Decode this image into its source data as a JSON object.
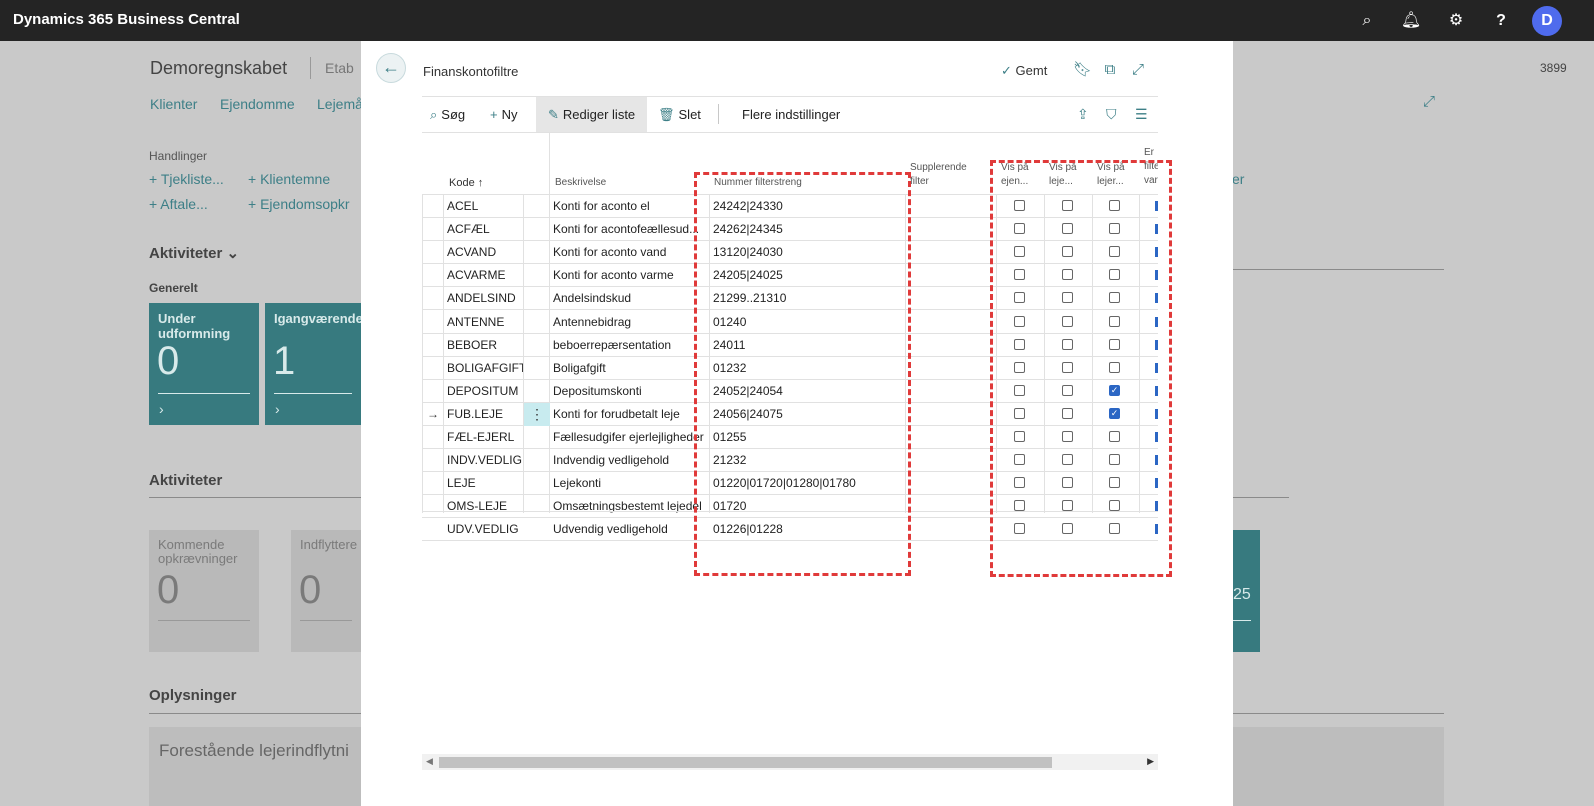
{
  "app": {
    "title": "Dynamics 365 Business Central",
    "avatar_initial": "D"
  },
  "background": {
    "company": "Demoregnskabet",
    "company_suffix": "Etab",
    "number": "3899",
    "nav": [
      "Klienter",
      "Ejendomme",
      "Lejemå"
    ],
    "actions_heading": "Handlinger",
    "actions": [
      "Tjekliste...",
      "Klientemne",
      "Aftale...",
      "Ejendomsopkr"
    ],
    "right_link": "er",
    "activities1": "Aktiviteter",
    "general": "Generelt",
    "tiles": [
      {
        "title": "Under udformning",
        "value": "0"
      },
      {
        "title": "Igangværende",
        "value": "1"
      }
    ],
    "activities2": "Aktiviteter",
    "gtiles": [
      {
        "title": "Kommende opkrævninger",
        "value": "0"
      },
      {
        "title": "Indflyttere",
        "value": "0"
      }
    ],
    "right_tile_value": "25",
    "info": "Oplysninger",
    "info_card": "Forestående lejerindflytni"
  },
  "dialog": {
    "title": "Finanskontofiltre",
    "saved": "Gemt",
    "toolbar": {
      "search": "Søg",
      "new": "Ny",
      "edit_list": "Rediger liste",
      "delete": "Slet",
      "more": "Flere indstillinger"
    },
    "columns": {
      "kode": "Kode ↑",
      "beskrivelse": "Beskrivelse",
      "nummer": "Nummer filterstreng",
      "suppl1": "Supplerende",
      "suppl2": "filter",
      "vis1a": "Vis på",
      "vis1b": "ejen...",
      "vis2a": "Vis på",
      "vis2b": "leje...",
      "vis3a": "Vis på",
      "vis3b": "lejer...",
      "er1": "Er",
      "er2": "filte",
      "er3": "vari"
    },
    "rows": [
      {
        "kode": "ACEL",
        "beskrivelse": "Konti for aconto el",
        "nummer": "24242|24330",
        "c1": false,
        "c2": false,
        "c3": false
      },
      {
        "kode": "ACFÆL",
        "beskrivelse": "Konti for acontofeællesud...",
        "nummer": "24262|24345",
        "c1": false,
        "c2": false,
        "c3": false
      },
      {
        "kode": "ACVAND",
        "beskrivelse": "Konti for aconto vand",
        "nummer": "13120|24030",
        "c1": false,
        "c2": false,
        "c3": false
      },
      {
        "kode": "ACVARME",
        "beskrivelse": "Konti for aconto varme",
        "nummer": "24205|24025",
        "c1": false,
        "c2": false,
        "c3": false
      },
      {
        "kode": "ANDELSIND",
        "beskrivelse": "Andelsindskud",
        "nummer": "21299..21310",
        "c1": false,
        "c2": false,
        "c3": false
      },
      {
        "kode": "ANTENNE",
        "beskrivelse": "Antennebidrag",
        "nummer": "01240",
        "c1": false,
        "c2": false,
        "c3": false
      },
      {
        "kode": "BEBOER",
        "beskrivelse": "beboerrepærsentation",
        "nummer": "24011",
        "c1": false,
        "c2": false,
        "c3": false
      },
      {
        "kode": "BOLIGAFGIFT",
        "beskrivelse": "Boligafgift",
        "nummer": "01232",
        "c1": false,
        "c2": false,
        "c3": false
      },
      {
        "kode": "DEPOSITUM",
        "beskrivelse": "Depositumskonti",
        "nummer": "24052|24054",
        "c1": false,
        "c2": false,
        "c3": true
      },
      {
        "kode": "FUB.LEJE",
        "beskrivelse": "Konti for forudbetalt leje",
        "nummer": "24056|24075",
        "c1": false,
        "c2": false,
        "c3": true
      },
      {
        "kode": "FÆL-EJERL",
        "beskrivelse": "Fællesudgifer ejerlejligheder",
        "nummer": "01255",
        "c1": false,
        "c2": false,
        "c3": false
      },
      {
        "kode": "INDV.VEDLIG",
        "beskrivelse": "Indvendig vedligehold",
        "nummer": "21232",
        "c1": false,
        "c2": false,
        "c3": false
      },
      {
        "kode": "LEJE",
        "beskrivelse": "Lejekonti",
        "nummer": "01220|01720|01280|01780",
        "c1": false,
        "c2": false,
        "c3": false
      },
      {
        "kode": "OMS-LEJE",
        "beskrivelse": "Omsætningsbestemt lejedel",
        "nummer": "01720",
        "c1": false,
        "c2": false,
        "c3": false
      },
      {
        "kode": "UDV.VEDLIG",
        "beskrivelse": "Udvendig vedligehold",
        "nummer": "01226|01228",
        "c1": false,
        "c2": false,
        "c3": false
      }
    ],
    "active_row": 9
  },
  "colors": {
    "accent": "#3d7f87",
    "highlight": "#e03a3a",
    "checkbox": "#2b66c4"
  }
}
